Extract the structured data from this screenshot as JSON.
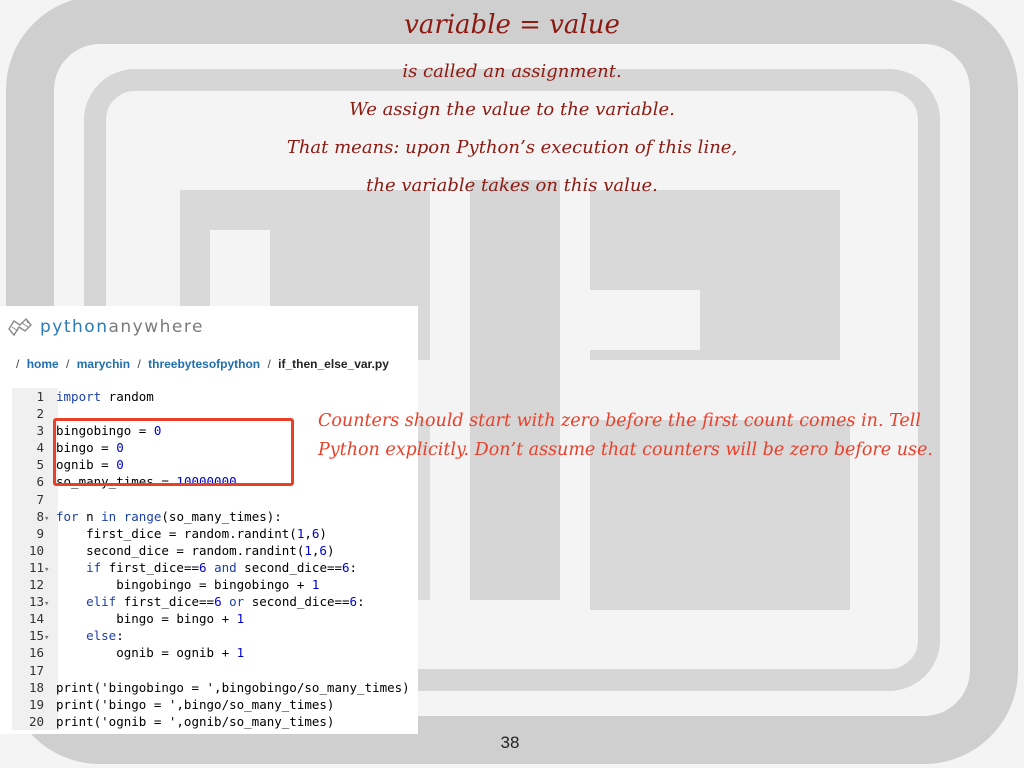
{
  "slide": {
    "title": "variable = value",
    "lines": [
      "is called an assignment.",
      "We assign the value to the variable.",
      "That means: upon Python’s execution of this line,",
      "the variable takes on this value."
    ],
    "annotation": "Counters should start with zero before the first count comes in. Tell Python explicitly. Don’t assume that counters will be zero before use.",
    "page_number": "38"
  },
  "pythonanywhere": {
    "logo_prefix": "python",
    "logo_suffix": "anywhere",
    "breadcrumb": {
      "sep": "/",
      "home": "home",
      "user": "marychin",
      "folder": "threebytesofpython",
      "file": "if_then_else_var.py"
    }
  },
  "code": {
    "lines": [
      {
        "n": "1",
        "fold": "",
        "text": "import random"
      },
      {
        "n": "2",
        "fold": "",
        "text": ""
      },
      {
        "n": "3",
        "fold": "",
        "text": "bingobingo = 0"
      },
      {
        "n": "4",
        "fold": "",
        "text": "bingo = 0"
      },
      {
        "n": "5",
        "fold": "",
        "text": "ognib = 0"
      },
      {
        "n": "6",
        "fold": "",
        "text": "so_many_times = 10000000"
      },
      {
        "n": "7",
        "fold": "",
        "text": ""
      },
      {
        "n": "8",
        "fold": "▾",
        "text": "for n in range(so_many_times):"
      },
      {
        "n": "9",
        "fold": "",
        "text": "    first_dice = random.randint(1,6)"
      },
      {
        "n": "10",
        "fold": "",
        "text": "    second_dice = random.randint(1,6)"
      },
      {
        "n": "11",
        "fold": "▾",
        "text": "    if first_dice==6 and second_dice==6:"
      },
      {
        "n": "12",
        "fold": "",
        "text": "        bingobingo = bingobingo + 1"
      },
      {
        "n": "13",
        "fold": "▾",
        "text": "    elif first_dice==6 or second_dice==6:"
      },
      {
        "n": "14",
        "fold": "",
        "text": "        bingo = bingo + 1"
      },
      {
        "n": "15",
        "fold": "▾",
        "text": "    else:"
      },
      {
        "n": "16",
        "fold": "",
        "text": "        ognib = ognib + 1"
      },
      {
        "n": "17",
        "fold": "",
        "text": ""
      },
      {
        "n": "18",
        "fold": "",
        "text": "print('bingobingo = ',bingobingo/so_many_times)"
      },
      {
        "n": "19",
        "fold": "",
        "text": "print('bingo = ',bingo/so_many_times)"
      },
      {
        "n": "20",
        "fold": "",
        "text": "print('ognib = ',ognib/so_many_times)"
      }
    ]
  },
  "colors": {
    "title": "#8b1a12",
    "annotation": "#e8402a",
    "highlight_box": "#e8402a",
    "link": "#1f6fb0"
  }
}
